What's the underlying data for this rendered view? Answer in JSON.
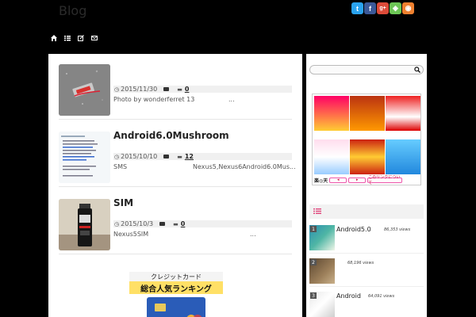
{
  "header": {
    "blog_title": "Blog",
    "social_icons": [
      "twitter-icon",
      "facebook-icon",
      "google-plus-icon",
      "feedly-icon",
      "rss-icon"
    ],
    "social_colors": [
      "#2aa3ef",
      "#3b5998",
      "#dd4b39",
      "#6cc655",
      "#ee802f"
    ]
  },
  "nav": {
    "icons": [
      "home-icon",
      "list-icon",
      "edit-icon",
      "mail-icon"
    ]
  },
  "posts": [
    {
      "title": "",
      "date": "2015/11/30",
      "comments": "0",
      "excerpt": "Photo by wonderferret 13",
      "excerpt_tail": "..."
    },
    {
      "title": "Android6.0Mushroom",
      "date": "2015/10/10",
      "comments": "12",
      "excerpt": "SMS",
      "excerpt_tail": "Nexus5,Nexus6Android6.0Mus..."
    },
    {
      "title": "SIM",
      "date": "2015/10/3",
      "comments": "0",
      "excerpt": "Nexus5SIM",
      "excerpt_tail": "..."
    }
  ],
  "ad_left": {
    "line1": "クレジットカード",
    "line2": "総合人気ランキング"
  },
  "sidebar": {
    "ad_footer": {
      "brand": "楽◎天",
      "link": "このリンクについて"
    },
    "popular": [
      {
        "rank": "1",
        "title": "Android5.0",
        "views": "86,353 views"
      },
      {
        "rank": "2",
        "title": "",
        "views": "68,196 views"
      },
      {
        "rank": "3",
        "title": "Android",
        "views": "64,091 views"
      }
    ]
  },
  "colors": {
    "accent": "#e0457b",
    "meta_bg": "#f0f0f0",
    "page_bg": "#000000"
  }
}
